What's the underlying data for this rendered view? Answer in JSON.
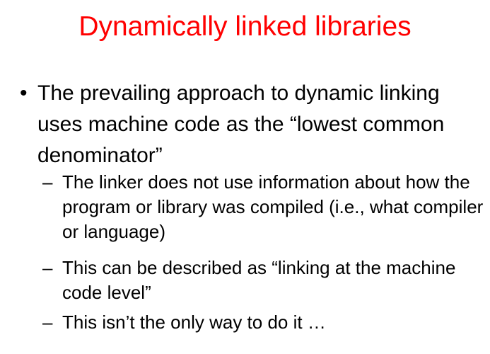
{
  "slide": {
    "title": "Dynamically linked libraries",
    "title_color": "#ff0000",
    "bullet": {
      "marker": "•",
      "text": "The prevailing approach to dynamic linking uses machine code as the “lowest common denominator”"
    },
    "sub_bullets": [
      {
        "marker": "–",
        "text": "The linker does not use information about how the program or library was compiled (i.e., what compiler or language)"
      },
      {
        "marker": "–",
        "text": "This can be described as “linking at the machine code level”"
      },
      {
        "marker": "–",
        "text": "This isn’t the only way to do it …"
      }
    ]
  }
}
